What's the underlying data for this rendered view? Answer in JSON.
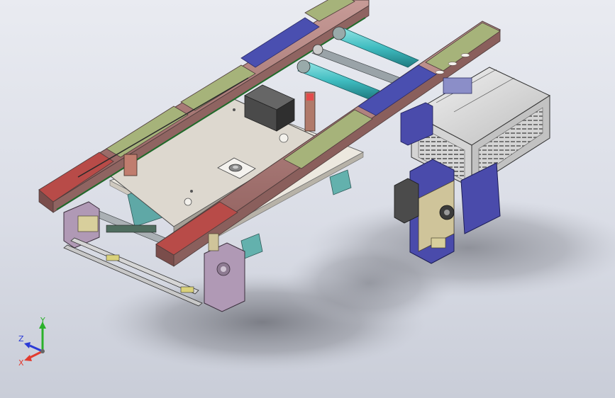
{
  "viewport": {
    "background_top": "#e9ebf1",
    "background_bottom": "#c9cdd8"
  },
  "model": {
    "parts": [
      "aluminum-rail-frame",
      "linear-guide-rails",
      "ball-screw-shafts",
      "stepper-motor-left",
      "servo-motor-right",
      "motor-gearbox-housing",
      "drive-pulley-bracket",
      "slide-table-plate",
      "support-feet",
      "limit-switches"
    ],
    "colors": {
      "rail": "#a8706d",
      "rail_segment_red": "#b84b48",
      "rail_segment_green": "#a6b37a",
      "rail_segment_blue": "#4a4fb0",
      "shaft": "#3fbcc0",
      "plate": "#dcd7cf",
      "base_plate": "#e9e4dc",
      "bracket_purple": "#a98ab0",
      "bracket_navy": "#46479c",
      "motor": "#4a4a4a",
      "housing": "#d8d8d8",
      "support_teal": "#67b7b3",
      "brass": "#c8b98a"
    }
  },
  "triad": {
    "x_label": "X",
    "y_label": "Y",
    "z_label": "Z",
    "x_color": "#e23b2f",
    "y_color": "#2bb12b",
    "z_color": "#2b3bd6"
  }
}
